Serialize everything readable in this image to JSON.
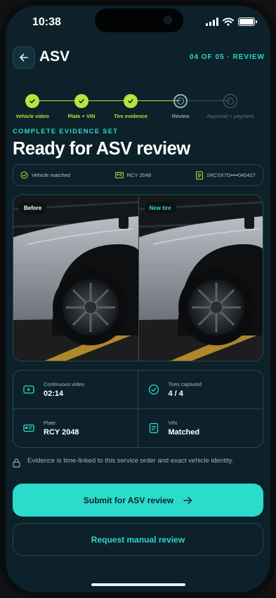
{
  "status_bar": {
    "time": "10:38"
  },
  "header": {
    "title": "ASV",
    "step_counter": "04 OF 05 · REVIEW"
  },
  "stepper": {
    "steps": [
      {
        "label": "Vehicle video",
        "state": "done"
      },
      {
        "label": "Plate + VIN",
        "state": "done"
      },
      {
        "label": "Tire evidence",
        "state": "done"
      },
      {
        "label": "Review",
        "state": "current"
      },
      {
        "label": "Approval + payment",
        "state": "pending"
      }
    ]
  },
  "kicker": "COMPLETE EVIDENCE SET",
  "headline": "Ready for ASV review",
  "identity": {
    "vehicle": "Vehicle matched",
    "plate": "RCY 2048",
    "vin": "1RCSX7D••••040427"
  },
  "photos": {
    "before_label": "Before",
    "after_label": "New tire"
  },
  "stats": [
    {
      "caption": "Continuous video",
      "value": "02:14",
      "icon": "video-icon"
    },
    {
      "caption": "Tires captured",
      "value": "4 / 4",
      "icon": "check-circle-icon"
    },
    {
      "caption": "Plate",
      "value": "RCY 2048",
      "icon": "plate-icon"
    },
    {
      "caption": "VIN",
      "value": "Matched",
      "icon": "document-icon"
    }
  ],
  "note": "Evidence is time-linked to this service order and exact vehicle identity.",
  "actions": {
    "primary": "Submit for ASV review",
    "secondary": "Request manual review"
  },
  "colors": {
    "background": "#0c2129",
    "accent_teal": "#2bdccc",
    "accent_lime": "#b6e33f"
  }
}
